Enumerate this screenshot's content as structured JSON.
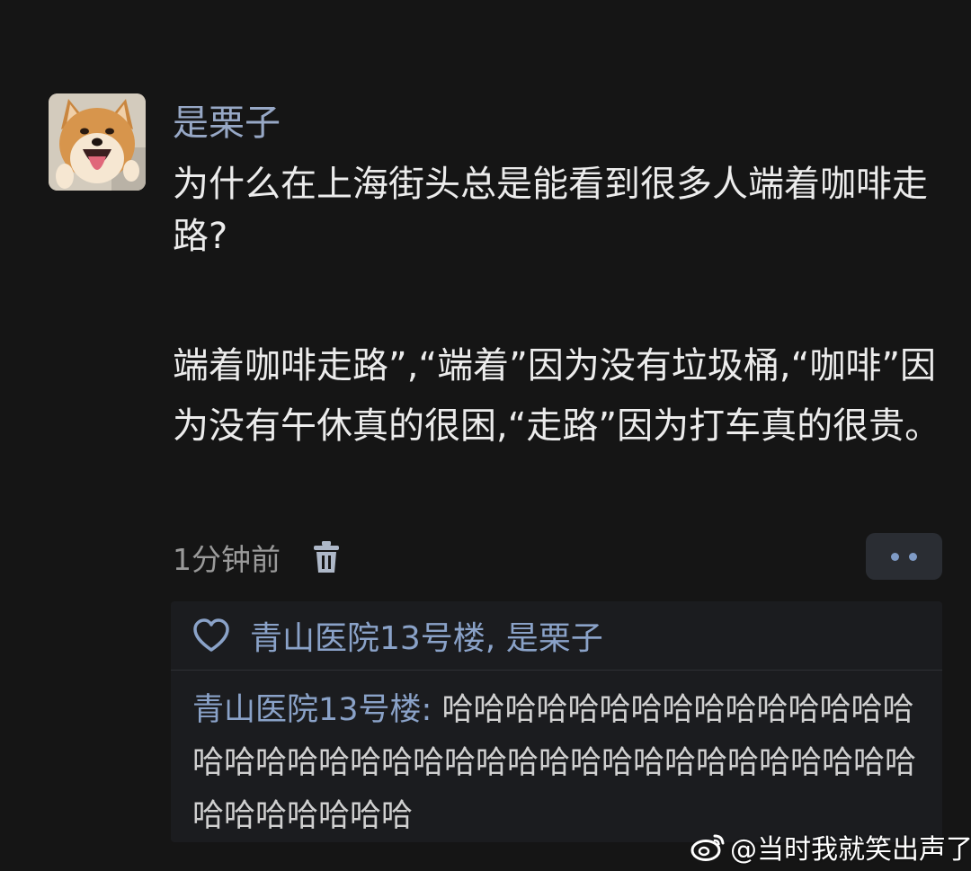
{
  "post": {
    "author": "是栗子",
    "question": "为什么在上海街头总是能看到很多人端着咖啡走路?",
    "answer": "端着咖啡走路”,“端着”因为没有垃圾桶,“咖啡”因为没有午休真的很困,“走路”因为打车真的很贵。",
    "timestamp": "1分钟前"
  },
  "reply": {
    "likes": "青山医院13号楼, 是栗子",
    "comment_author": "青山医院13号楼:",
    "comment_text": " 哈哈哈哈哈哈哈哈哈哈哈哈哈哈哈哈哈哈哈哈哈哈哈哈哈哈哈哈哈哈哈哈哈哈哈哈哈哈哈哈哈哈哈哈哈"
  },
  "watermark": {
    "text": "@当时我就笑出声了",
    "logo": "weibo-logo"
  },
  "icons": {
    "avatar": "shiba-dog-avatar",
    "delete": "trash-icon",
    "more": "more-dots-icon",
    "like": "heart-icon"
  },
  "colors": {
    "background": "#151515",
    "link": "#8aa2c8",
    "reply_box": "#1b1c1f"
  }
}
